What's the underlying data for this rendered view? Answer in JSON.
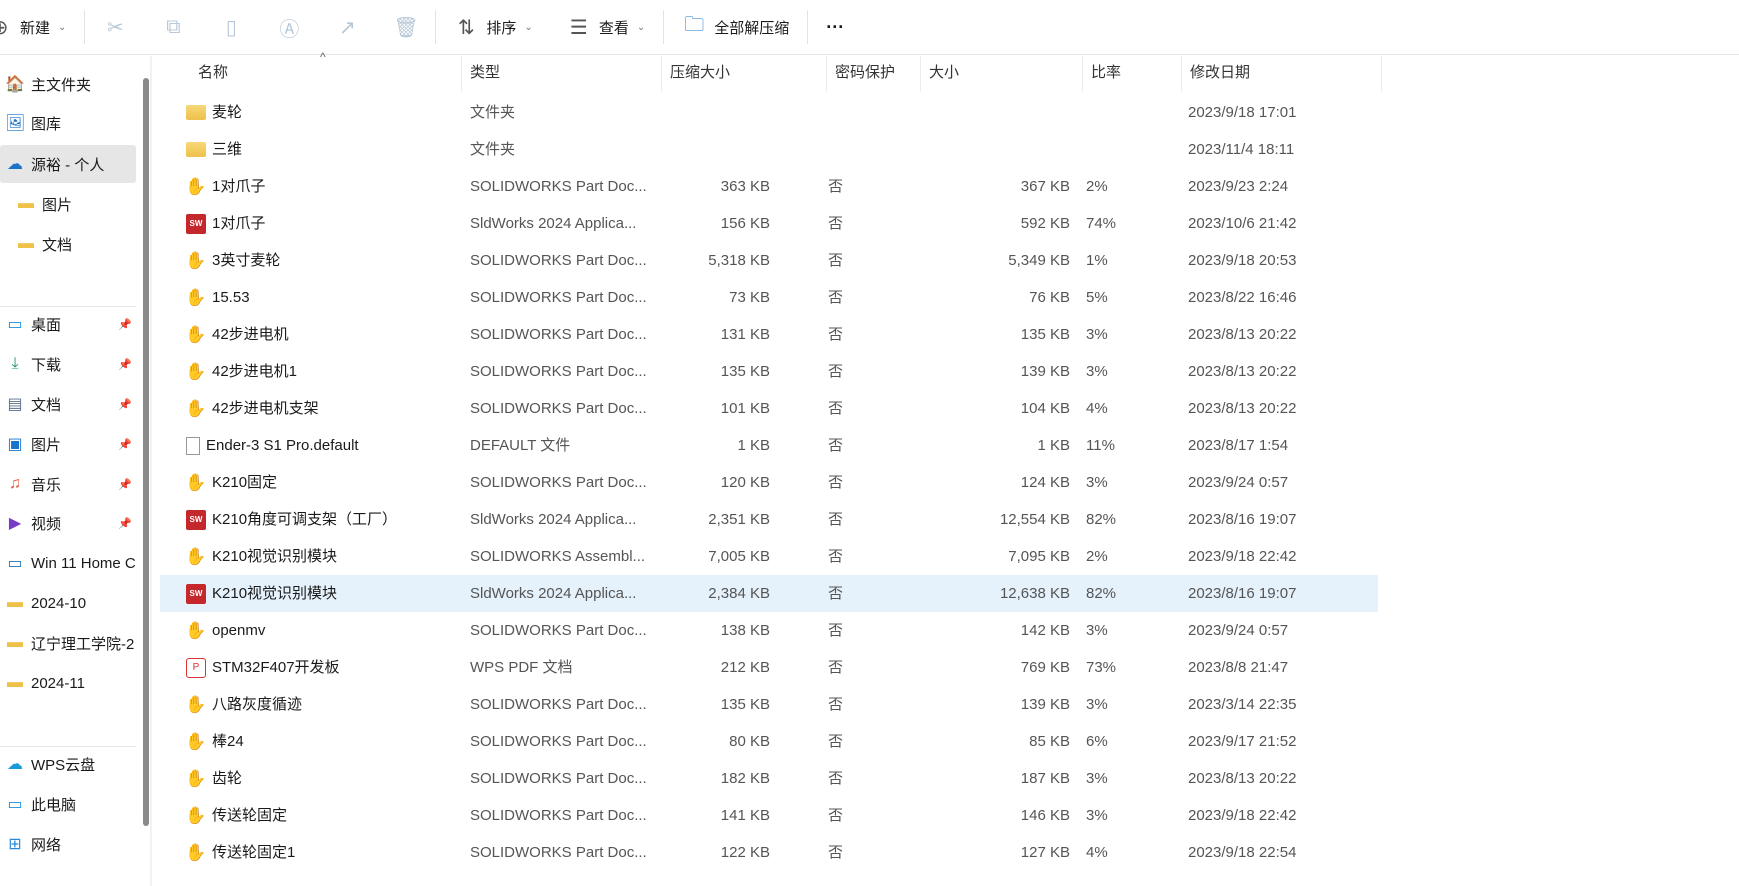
{
  "toolbar": {
    "new": "新建",
    "sort": "排序",
    "view": "查看",
    "extract_all": "全部解压缩",
    "more": "···"
  },
  "sidebar": {
    "items": [
      {
        "label": "主文件夹",
        "icon": "home"
      },
      {
        "label": "图库",
        "icon": "gallery"
      },
      {
        "label": "源裕 - 个人",
        "icon": "onedrive"
      },
      {
        "label": "图片",
        "icon": "folder"
      },
      {
        "label": "文档",
        "icon": "folder"
      },
      {
        "label": "桌面",
        "icon": "desktop"
      },
      {
        "label": "下载",
        "icon": "download"
      },
      {
        "label": "文档",
        "icon": "documents"
      },
      {
        "label": "图片",
        "icon": "pictures"
      },
      {
        "label": "音乐",
        "icon": "music"
      },
      {
        "label": "视频",
        "icon": "video"
      },
      {
        "label": "Win 11 Home C",
        "icon": "drive"
      },
      {
        "label": "2024-10",
        "icon": "folder"
      },
      {
        "label": "辽宁理工学院-2",
        "icon": "folder"
      },
      {
        "label": "2024-11",
        "icon": "folder"
      },
      {
        "label": "WPS云盘",
        "icon": "cloud"
      },
      {
        "label": "此电脑",
        "icon": "pc"
      },
      {
        "label": "网络",
        "icon": "network"
      }
    ]
  },
  "columns": {
    "name": "名称",
    "type": "类型",
    "compressed": "压缩大小",
    "password": "密码保护",
    "size": "大小",
    "ratio": "比率",
    "modified": "修改日期"
  },
  "files": [
    {
      "name": "麦轮",
      "icon": "folder",
      "type": "文件夹",
      "compressed": "",
      "password": "",
      "size": "",
      "ratio": "",
      "modified": "2023/9/18 17:01"
    },
    {
      "name": "三维",
      "icon": "folder",
      "type": "文件夹",
      "compressed": "",
      "password": "",
      "size": "",
      "ratio": "",
      "modified": "2023/11/4 18:11"
    },
    {
      "name": "1对爪子",
      "icon": "part",
      "type": "SOLIDWORKS Part Doc...",
      "compressed": "363 KB",
      "password": "否",
      "size": "367 KB",
      "ratio": "2%",
      "modified": "2023/9/23 2:24"
    },
    {
      "name": "1对爪子",
      "icon": "sw",
      "type": "SldWorks 2024 Applica...",
      "compressed": "156 KB",
      "password": "否",
      "size": "592 KB",
      "ratio": "74%",
      "modified": "2023/10/6 21:42"
    },
    {
      "name": "3英寸麦轮",
      "icon": "part",
      "type": "SOLIDWORKS Part Doc...",
      "compressed": "5,318 KB",
      "password": "否",
      "size": "5,349 KB",
      "ratio": "1%",
      "modified": "2023/9/18 20:53"
    },
    {
      "name": "15.53",
      "icon": "part",
      "type": "SOLIDWORKS Part Doc...",
      "compressed": "73 KB",
      "password": "否",
      "size": "76 KB",
      "ratio": "5%",
      "modified": "2023/8/22 16:46"
    },
    {
      "name": "42步进电机",
      "icon": "part",
      "type": "SOLIDWORKS Part Doc...",
      "compressed": "131 KB",
      "password": "否",
      "size": "135 KB",
      "ratio": "3%",
      "modified": "2023/8/13 20:22"
    },
    {
      "name": "42步进电机1",
      "icon": "part",
      "type": "SOLIDWORKS Part Doc...",
      "compressed": "135 KB",
      "password": "否",
      "size": "139 KB",
      "ratio": "3%",
      "modified": "2023/8/13 20:22"
    },
    {
      "name": "42步进电机支架",
      "icon": "part",
      "type": "SOLIDWORKS Part Doc...",
      "compressed": "101 KB",
      "password": "否",
      "size": "104 KB",
      "ratio": "4%",
      "modified": "2023/8/13 20:22"
    },
    {
      "name": "Ender-3 S1 Pro.default",
      "icon": "file",
      "type": "DEFAULT 文件",
      "compressed": "1 KB",
      "password": "否",
      "size": "1 KB",
      "ratio": "11%",
      "modified": "2023/8/17 1:54"
    },
    {
      "name": "K210固定",
      "icon": "part",
      "type": "SOLIDWORKS Part Doc...",
      "compressed": "120 KB",
      "password": "否",
      "size": "124 KB",
      "ratio": "3%",
      "modified": "2023/9/24 0:57"
    },
    {
      "name": "K210角度可调支架（工厂）",
      "icon": "sw",
      "type": "SldWorks 2024 Applica...",
      "compressed": "2,351 KB",
      "password": "否",
      "size": "12,554 KB",
      "ratio": "82%",
      "modified": "2023/8/16 19:07"
    },
    {
      "name": "K210视觉识别模块",
      "icon": "asm",
      "type": "SOLIDWORKS Assembl...",
      "compressed": "7,005 KB",
      "password": "否",
      "size": "7,095 KB",
      "ratio": "2%",
      "modified": "2023/9/18 22:42"
    },
    {
      "name": "K210视觉识别模块",
      "icon": "sw",
      "type": "SldWorks 2024 Applica...",
      "compressed": "2,384 KB",
      "password": "否",
      "size": "12,638 KB",
      "ratio": "82%",
      "modified": "2023/8/16 19:07",
      "selected": true
    },
    {
      "name": "openmv",
      "icon": "part",
      "type": "SOLIDWORKS Part Doc...",
      "compressed": "138 KB",
      "password": "否",
      "size": "142 KB",
      "ratio": "3%",
      "modified": "2023/9/24 0:57"
    },
    {
      "name": "STM32F407开发板",
      "icon": "pdf",
      "type": "WPS PDF 文档",
      "compressed": "212 KB",
      "password": "否",
      "size": "769 KB",
      "ratio": "73%",
      "modified": "2023/8/8 21:47"
    },
    {
      "name": "八路灰度循迹",
      "icon": "part",
      "type": "SOLIDWORKS Part Doc...",
      "compressed": "135 KB",
      "password": "否",
      "size": "139 KB",
      "ratio": "3%",
      "modified": "2023/3/14 22:35"
    },
    {
      "name": "棒24",
      "icon": "part",
      "type": "SOLIDWORKS Part Doc...",
      "compressed": "80 KB",
      "password": "否",
      "size": "85 KB",
      "ratio": "6%",
      "modified": "2023/9/17 21:52"
    },
    {
      "name": "齿轮",
      "icon": "part",
      "type": "SOLIDWORKS Part Doc...",
      "compressed": "182 KB",
      "password": "否",
      "size": "187 KB",
      "ratio": "3%",
      "modified": "2023/8/13 20:22"
    },
    {
      "name": "传送轮固定",
      "icon": "part",
      "type": "SOLIDWORKS Part Doc...",
      "compressed": "141 KB",
      "password": "否",
      "size": "146 KB",
      "ratio": "3%",
      "modified": "2023/9/18 22:42"
    },
    {
      "name": "传送轮固定1",
      "icon": "part",
      "type": "SOLIDWORKS Part Doc...",
      "compressed": "122 KB",
      "password": "否",
      "size": "127 KB",
      "ratio": "4%",
      "modified": "2023/9/18 22:54"
    }
  ]
}
